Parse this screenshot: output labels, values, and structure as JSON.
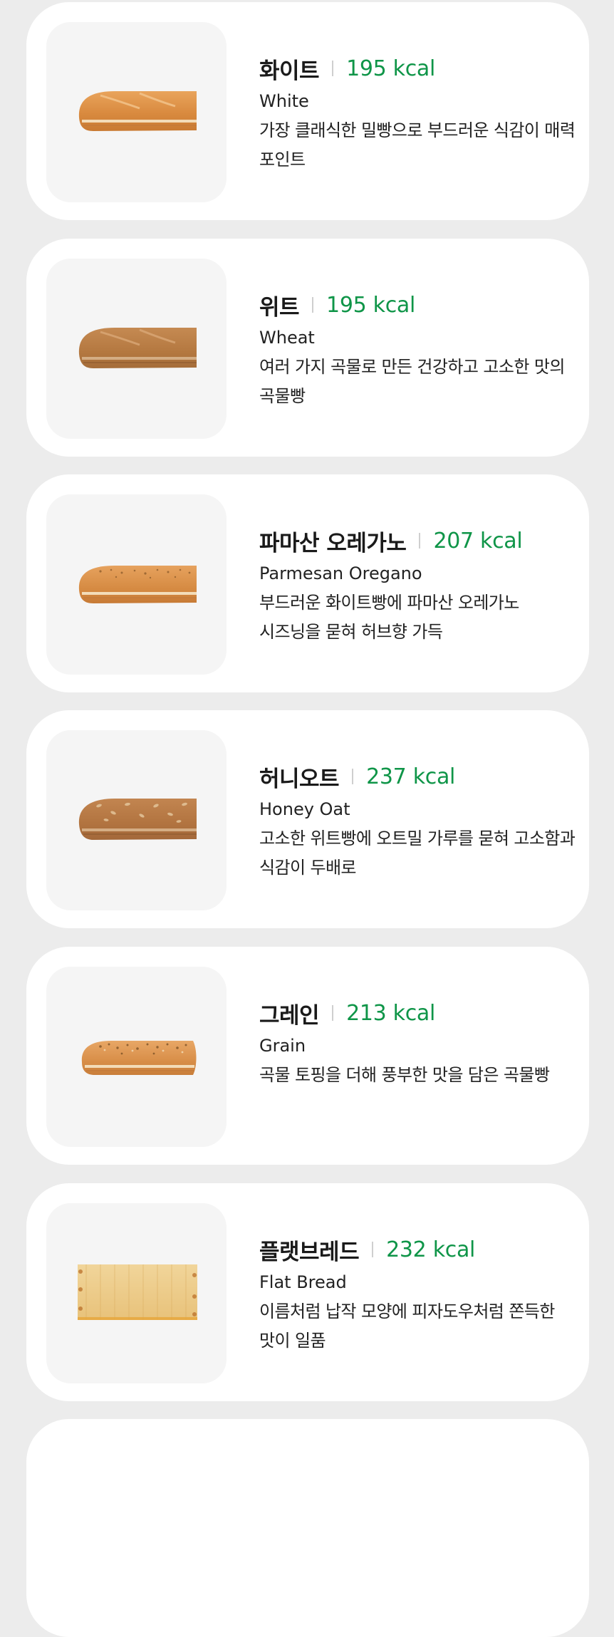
{
  "breads": [
    {
      "name_ko": "화이트",
      "kcal": "195 kcal",
      "name_en": "White",
      "description": "가장 클래식한 밀빵으로 부드러운 식감이 매력 포인트",
      "image_icon": "white-bread-icon"
    },
    {
      "name_ko": "위트",
      "kcal": "195 kcal",
      "name_en": "Wheat",
      "description": "여러 가지 곡물로 만든 건강하고 고소한 맛의 곡물빵",
      "image_icon": "wheat-bread-icon"
    },
    {
      "name_ko": "파마산 오레가노",
      "kcal": "207 kcal",
      "name_en": "Parmesan Oregano",
      "description": "부드러운 화이트빵에 파마산 오레가노 시즈닝을 묻혀 허브향 가득",
      "image_icon": "parmesan-oregano-bread-icon"
    },
    {
      "name_ko": "허니오트",
      "kcal": "237 kcal",
      "name_en": "Honey Oat",
      "description": "고소한 위트빵에 오트밀 가루를 묻혀 고소함과 식감이 두배로",
      "image_icon": "honey-oat-bread-icon"
    },
    {
      "name_ko": "그레인",
      "kcal": "213 kcal",
      "name_en": "Grain",
      "description": "곡물 토핑을 더해 풍부한 맛을 담은 곡물빵",
      "image_icon": "grain-bread-icon"
    },
    {
      "name_ko": "플랫브레드",
      "kcal": "232 kcal",
      "name_en": "Flat Bread",
      "description": "이름처럼 납작 모양에 피자도우처럼 쫀득한 맛이 일품",
      "image_icon": "flat-bread-icon"
    }
  ],
  "colors": {
    "background": "#ececec",
    "card": "#ffffff",
    "thumb": "#f5f5f5",
    "kcal_green": "#0f9548"
  }
}
